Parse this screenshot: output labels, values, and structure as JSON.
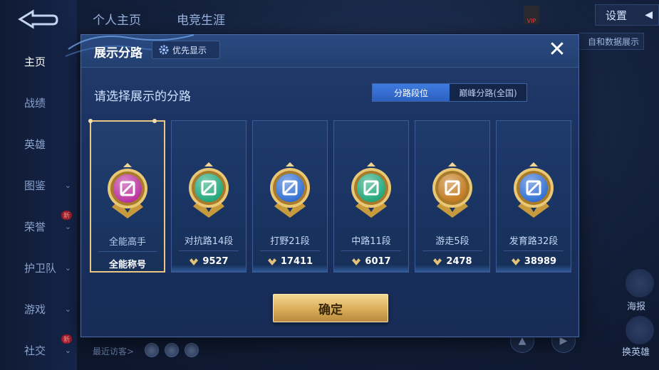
{
  "background": {
    "sidebar": {
      "items": [
        {
          "label": "主页",
          "chevron": false,
          "new_badge": false,
          "active": true
        },
        {
          "label": "战绩",
          "chevron": false,
          "new_badge": false,
          "active": false
        },
        {
          "label": "英雄",
          "chevron": false,
          "new_badge": false,
          "active": false
        },
        {
          "label": "图鉴",
          "chevron": true,
          "new_badge": false,
          "active": false
        },
        {
          "label": "荣誉",
          "chevron": true,
          "new_badge": true,
          "active": false
        },
        {
          "label": "护卫队",
          "chevron": true,
          "new_badge": false,
          "active": false
        },
        {
          "label": "游戏",
          "chevron": true,
          "new_badge": false,
          "active": false
        },
        {
          "label": "社交",
          "chevron": true,
          "new_badge": true,
          "active": false
        }
      ],
      "new_badge_text": "新"
    },
    "top_tabs": [
      "个人主页",
      "电竞生涯"
    ],
    "settings_label": "设置",
    "vip_label": "VIP",
    "data_button_label": "自和数据展示",
    "right_icons": [
      {
        "label": "海报",
        "icon": "poster-icon"
      },
      {
        "label": "换英雄",
        "icon": "swap-hero-icon"
      }
    ],
    "recent_visitors_label": "最近访客>"
  },
  "modal": {
    "title": "展示分路",
    "priority_label": "优先显示",
    "subtitle": "请选择展示的分路",
    "segment": {
      "options": [
        "分路段位",
        "巅峰分路(全国)"
      ],
      "selected": "分路段位"
    },
    "cards": [
      {
        "name": "全能高手",
        "value": "全能称号",
        "selected": true,
        "emblem_color": "#b9309e",
        "emblem": "all-round-emblem-icon",
        "show_value_icon": false
      },
      {
        "name": "对抗路14段",
        "value": "9527",
        "selected": false,
        "emblem_color": "#1fa67a",
        "emblem": "clash-lane-emblem-icon",
        "show_value_icon": true
      },
      {
        "name": "打野21段",
        "value": "17411",
        "selected": false,
        "emblem_color": "#2f6ed3",
        "emblem": "jungle-emblem-icon",
        "show_value_icon": true
      },
      {
        "name": "中路11段",
        "value": "6017",
        "selected": false,
        "emblem_color": "#1fa67a",
        "emblem": "mid-lane-emblem-icon",
        "show_value_icon": true
      },
      {
        "name": "游走5段",
        "value": "2478",
        "selected": false,
        "emblem_color": "#c27a1d",
        "emblem": "roam-emblem-icon",
        "show_value_icon": true
      },
      {
        "name": "发育路32段",
        "value": "38989",
        "selected": false,
        "emblem_color": "#2f6ed3",
        "emblem": "farm-lane-emblem-icon",
        "show_value_icon": true
      }
    ],
    "confirm_label": "确定",
    "colors": {
      "accent_gold": "#e8c785",
      "accent_blue": "#3f7be0"
    }
  }
}
